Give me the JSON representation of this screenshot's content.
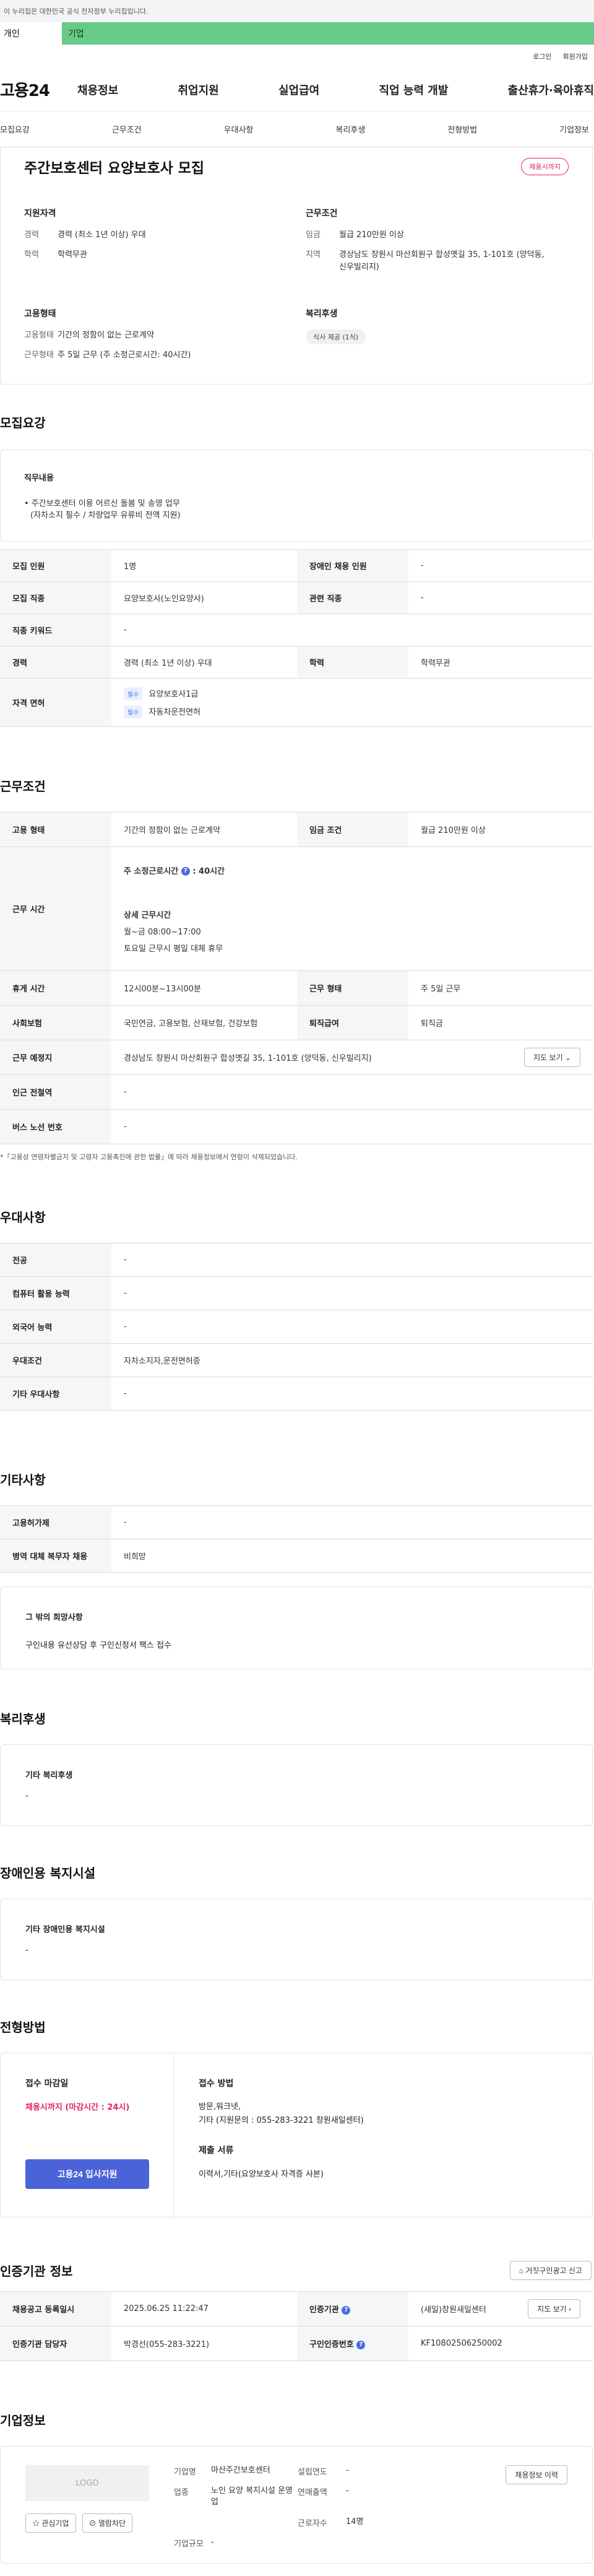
{
  "gov_bar": "이 누리집은 대한민국 공식 전자정부 누리집입니다.",
  "user_tabs": {
    "individual": "개인",
    "business": "기업"
  },
  "util": {
    "login": "로그인",
    "join": "회원가입"
  },
  "logo": "고용24",
  "gnb": [
    "채용정보",
    "취업지원",
    "실업급여",
    "직업 능력 개발",
    "출산휴가·육아휴직"
  ],
  "anchor_tabs": [
    "모집요강",
    "근무조건",
    "우대사항",
    "복리후생",
    "전형방법",
    "기업정보"
  ],
  "posting": {
    "title": "주간보호센터 요양보호사 모집",
    "status_badge": "채용시까지",
    "qualification_title": "지원자격",
    "qualification": [
      {
        "k": "경력",
        "v": "경력 (최소 1년 이상) 우대"
      },
      {
        "k": "학력",
        "v": "학력무관"
      }
    ],
    "work_title": "근무조건",
    "work": [
      {
        "k": "임금",
        "v": "월급 210만원 이상"
      },
      {
        "k": "지역",
        "v": "경상남도 창원시 마산회원구 합성옛길 35, 1-101호 (양덕동, 신우빌리지)"
      }
    ],
    "employment_title": "고용형태",
    "employment": [
      {
        "k": "고용형태",
        "v": "기간의 정함이 없는 근로계약"
      },
      {
        "k": "근무형태",
        "v": "주 5일 근무 (주 소정근로시간: 40시간)"
      }
    ],
    "benefit_title": "복리후생",
    "benefit_chip": "식사 제공 (1식)"
  },
  "recruit": {
    "section": "모집요강",
    "duty_title": "직무내용",
    "duty_lines": [
      "• 주간보호센터 이용 어르신 돌봄 및 송영 업무",
      "(자차소지 필수 / 차량업무 유류비 전액 지원)"
    ],
    "rows": {
      "headcount_k": "모집 인원",
      "headcount_v": "1명",
      "disabled_k": "장애인 채용 인원",
      "disabled_v": "-",
      "job_k": "모집 직종",
      "job_v": "요양보호사(노인요양사)",
      "related_k": "관련 직종",
      "related_v": "-",
      "keyword_k": "직종 키워드",
      "keyword_v": "-",
      "career_k": "경력",
      "career_v": "경력 (최소 1년 이상) 우대",
      "edu_k": "학력",
      "edu_v": "학력무관",
      "license_k": "자격 면허",
      "license": [
        {
          "tag": "필수",
          "v": "요양보호사1급"
        },
        {
          "tag": "필수",
          "v": "자동차운전면허"
        }
      ]
    }
  },
  "conditions": {
    "section": "근무조건",
    "emp_type_k": "고용 형태",
    "emp_type_v": "기간의 정함이 없는 근로계약",
    "wage_k": "임금 조건",
    "wage_v": "월급 210만원 이상",
    "hours_k": "근무 시간",
    "hours_weekly_label": "주 소정근로시간",
    "hours_weekly_value": ": 40시간",
    "hours_detail_title": "상세 근무시간",
    "hours_detail_1": "월~금 08:00~17:00",
    "hours_detail_2": "토요일 근무시 평일 대체 휴무",
    "rest_k": "휴게 시간",
    "rest_v": "12시00분~13시00분",
    "form_k": "근무 형태",
    "form_v": "주 5일 근무",
    "insurance_k": "사회보험",
    "insurance_v": "국민연금, 고용보험, 산재보험, 건강보험",
    "retire_k": "퇴직급여",
    "retire_v": "퇴직금",
    "place_k": "근무 예정지",
    "place_v": "경상남도 창원시 마산회원구 합성옛길 35, 1-101호 (양덕동, 신우빌리지)",
    "map_btn": "지도 보기 ⌄",
    "station_k": "인근 전철역",
    "station_v": "-",
    "bus_k": "버스 노선 번호",
    "bus_v": "-",
    "note": "*「고용상 연령차별금지 및 고령자 고용촉진에 관한 법률」에 따라 채용정보에서 연령이 삭제되었습니다."
  },
  "preferred": {
    "section": "우대사항",
    "rows": [
      {
        "k": "전공",
        "v": "-"
      },
      {
        "k": "컴퓨터 활용 능력",
        "v": "-"
      },
      {
        "k": "외국어 능력",
        "v": "-"
      },
      {
        "k": "우대조건",
        "v": "자차소지자,운전면허증"
      },
      {
        "k": "기타 우대사항",
        "v": "-"
      }
    ]
  },
  "etc": {
    "section": "기타사항",
    "rows": [
      {
        "k": "고용허가제",
        "v": "-"
      },
      {
        "k": "병역 대체 복무자 채용",
        "v": "비희망"
      }
    ],
    "hope_title": "그 밖의 희망사항",
    "hope_text": "구인내용 유선상담 후 구인신청서 팩스 접수"
  },
  "welfare": {
    "section": "복리후생",
    "title": "기타 복리후생",
    "value": "-"
  },
  "disability": {
    "section": "장애인용 복지시설",
    "title": "기타 장애인용 복지시설",
    "value": "-"
  },
  "screening": {
    "section": "전형방법",
    "deadline_title": "접수 마감일",
    "deadline_value": "채용시까지 (마감시간 : 24시)",
    "apply_btn": "고용24 입사지원",
    "method_title": "접수 방법",
    "method_1": "방문,워크넷,",
    "method_2": "기타 (지원문의 : 055-283-3221 창원새일센터)",
    "docs_title": "제출 서류",
    "docs_value": "이력서,기타(요양보호사 자격증 사본)"
  },
  "agency": {
    "section": "인증기관 정보",
    "report_btn": "거짓구인광고 신고",
    "reg_k": "채용공고 등록일시",
    "reg_v": "2025.06.25 11:22:47",
    "inst_k": "인증기관",
    "inst_v": "(새일)창원새일센터",
    "map_btn": "지도 보기 ›",
    "manager_k": "인증기관 담당자",
    "manager_v": "박경선(055-283-3221)",
    "num_k": "구인인증번호",
    "num_v": "KF10802506250002"
  },
  "company": {
    "section": "기업정보",
    "logo_placeholder": "LOGO",
    "fav_btn": "☆ 관심기업",
    "block_btn": "⊘ 열람차단",
    "history_btn": "채용정보 이력",
    "name_k": "기업명",
    "name_v": "마산주간보호센터",
    "year_k": "설립연도",
    "year_v": "-",
    "industry_k": "업종",
    "industry_v": "노인 요양 복지시설 운영업",
    "sales_k": "연매출액",
    "sales_v": "-",
    "staff_k": "근로자수",
    "staff_v": "14명",
    "size_k": "기업규모",
    "size_v": "-"
  }
}
